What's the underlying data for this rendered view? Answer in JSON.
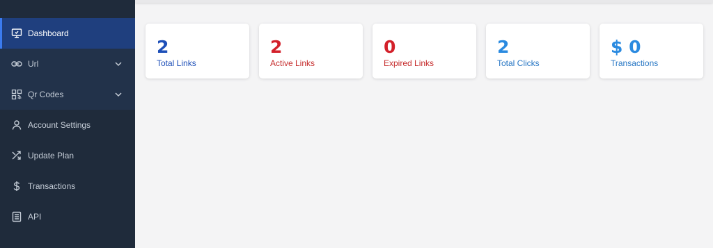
{
  "sidebar": {
    "items": [
      {
        "label": "Dashboard",
        "icon": "monitor-icon",
        "active": true
      },
      {
        "label": "Url",
        "icon": "link-icon",
        "expandable": true
      },
      {
        "label": "Qr Codes",
        "icon": "qr-code-icon",
        "expandable": true
      },
      {
        "label": "Account Settings",
        "icon": "user-icon"
      },
      {
        "label": "Update Plan",
        "icon": "shuffle-icon"
      },
      {
        "label": "Transactions",
        "icon": "dollar-icon"
      },
      {
        "label": "API",
        "icon": "document-icon"
      }
    ]
  },
  "stats": [
    {
      "value": "2",
      "label": "Total Links",
      "color": "#1d4fb8"
    },
    {
      "value": "2",
      "label": "Active Links",
      "color": "#d3202a"
    },
    {
      "value": "0",
      "label": "Expired Links",
      "color": "#d3202a"
    },
    {
      "value": "2",
      "label": "Total Clicks",
      "color": "#2a8ae0"
    },
    {
      "value": "$ 0",
      "label": "Transactions",
      "color": "#2a8ae0"
    }
  ],
  "colors": {
    "sidebar_bg": "#1f2b3b",
    "active_bg": "#1f3f7e",
    "page_bg": "#f4f4f5"
  }
}
